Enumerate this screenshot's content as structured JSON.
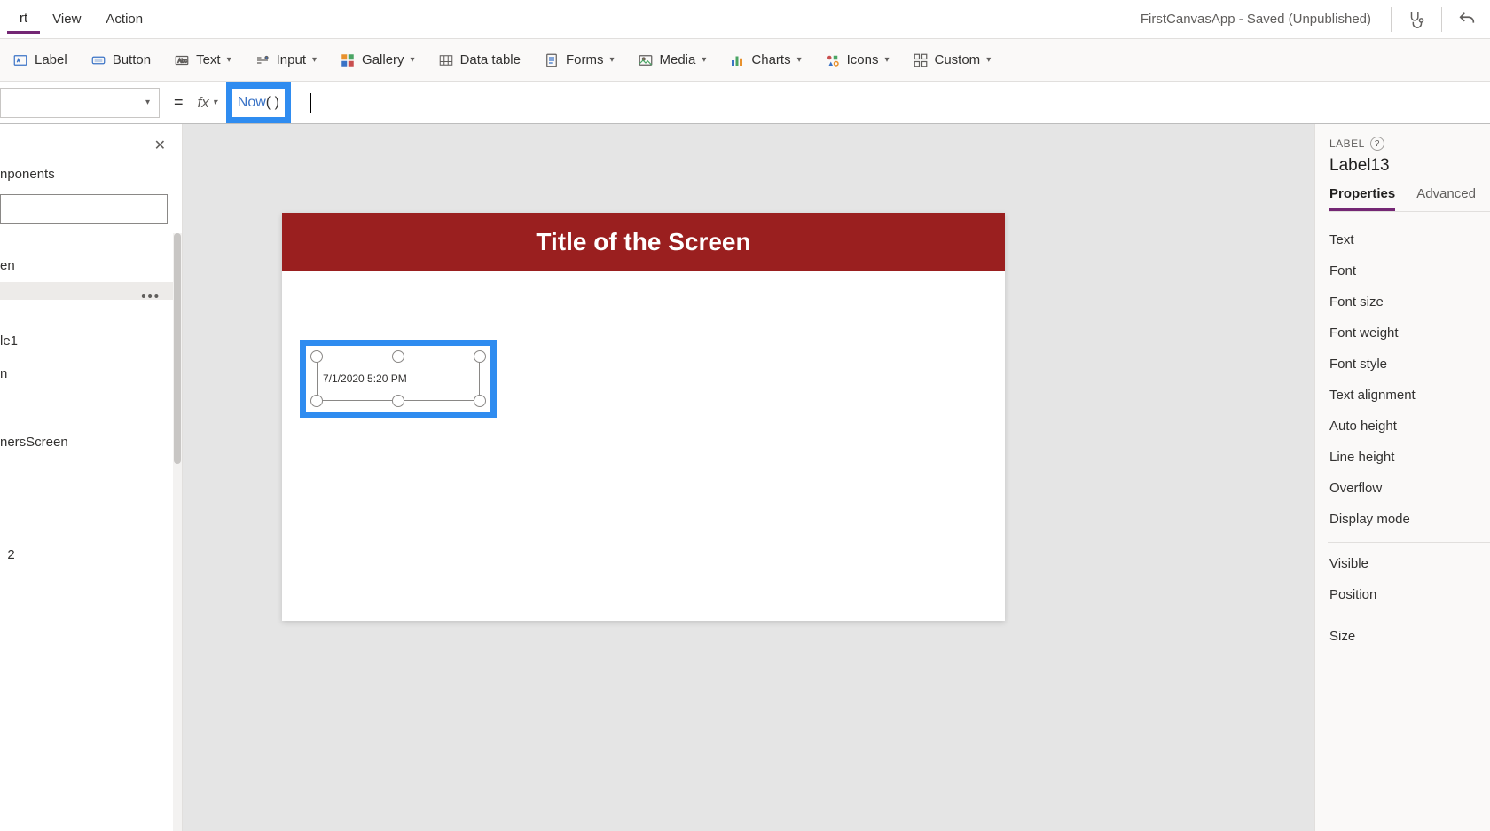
{
  "menubar": {
    "items": [
      "rt",
      "View",
      "Action"
    ],
    "active_index": 0,
    "app_status": "FirstCanvasApp - Saved (Unpublished)"
  },
  "ribbon": {
    "label": "Label",
    "button": "Button",
    "text": "Text",
    "input": "Input",
    "gallery": "Gallery",
    "data_table": "Data table",
    "forms": "Forms",
    "media": "Media",
    "charts": "Charts",
    "icons": "Icons",
    "custom": "Custom"
  },
  "formula_bar": {
    "equals": "=",
    "fx_label": "fx",
    "func_name": "Now",
    "parens": "( )"
  },
  "left_panel": {
    "tab_label": "nponents",
    "items": [
      {
        "label": "en",
        "selected": false
      },
      {
        "label": "",
        "selected": true
      },
      {
        "label": "le1",
        "selected": false
      },
      {
        "label": "n",
        "selected": false
      },
      {
        "label": "",
        "selected": false
      },
      {
        "label": "nersScreen",
        "selected": false
      },
      {
        "label": "",
        "selected": false
      },
      {
        "label": "",
        "selected": false
      },
      {
        "label": "_2",
        "selected": false
      }
    ]
  },
  "canvas": {
    "screen_title": "Title of the Screen",
    "selected_label_text": "7/1/2020 5:20 PM",
    "header_color": "#9a1f1f"
  },
  "right_panel": {
    "type_label": "LABEL",
    "control_name": "Label13",
    "tabs": [
      "Properties",
      "Advanced"
    ],
    "active_tab": 0,
    "properties_group1": [
      "Text",
      "Font",
      "Font size",
      "Font weight",
      "Font style",
      "Text alignment",
      "Auto height",
      "Line height",
      "Overflow",
      "Display mode"
    ],
    "properties_group2": [
      "Visible",
      "Position",
      "Size"
    ]
  }
}
